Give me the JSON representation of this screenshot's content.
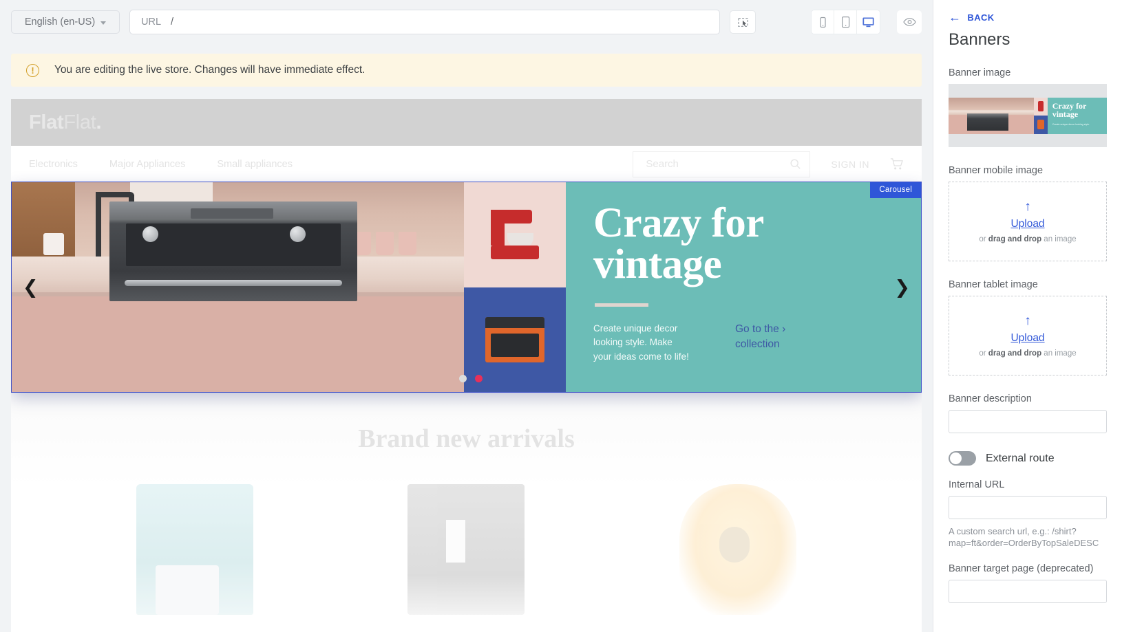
{
  "toolbar": {
    "language": "English (en-US)",
    "url_label": "URL",
    "url_value": "/",
    "select_tool_icon": "cursor-select-icon",
    "mobile_icon": "mobile-device-icon",
    "tablet_icon": "tablet-device-icon",
    "desktop_icon": "desktop-device-icon",
    "preview_icon": "eye-icon",
    "active_device": "desktop",
    "accent_color": "#2f56d8"
  },
  "notice": {
    "icon": "warning-circle-icon",
    "text": "You are editing the live store. Changes will have immediate effect.",
    "bg_color": "#fdf6e3",
    "icon_color": "#d3a02a"
  },
  "store": {
    "logo_bold": "Flat",
    "logo_light": "Flat",
    "logo_dot": ".",
    "nav": [
      {
        "label": "Electronics"
      },
      {
        "label": "Major Appliances"
      },
      {
        "label": "Small appliances"
      }
    ],
    "search_placeholder": "Search",
    "search_icon": "search-icon",
    "signin_label": "SIGN IN",
    "cart_icon": "shopping-cart-icon"
  },
  "carousel": {
    "badge": "Carousel",
    "prev_icon": "chevron-left-icon",
    "next_icon": "chevron-right-icon",
    "selected_outline_color": "#3f51c8",
    "teal_color": "#6cbdb7",
    "slide": {
      "title_line1": "Crazy for",
      "title_line2": "vintage",
      "description": "Create unique decor looking style. Make your ideas come to life!",
      "cta_line1": "Go to the ",
      "cta_chevron": "›",
      "cta_line2": "collection"
    },
    "dots": [
      {
        "active": false
      },
      {
        "active": true
      }
    ]
  },
  "arrivals": {
    "heading": "Brand new arrivals",
    "products": [
      {
        "name": "coffee-maker-teal"
      },
      {
        "name": "espresso-machine-silver"
      },
      {
        "name": "kettle-cream"
      }
    ]
  },
  "sidebar": {
    "back_label": "BACK",
    "back_icon": "arrow-left-icon",
    "title": "Banners",
    "banner_image_label": "Banner image",
    "banner_thumb": {
      "title_line1": "Crazy for",
      "title_line2": "vintage",
      "caption": "Create unique decor looking style."
    },
    "mobile_image_label": "Banner mobile image",
    "tablet_image_label": "Banner tablet image",
    "upload": {
      "icon": "upload-arrow-icon",
      "link": "Upload",
      "hint_pre": "or ",
      "hint_bold": "drag and drop",
      "hint_post": " an image"
    },
    "description_label": "Banner description",
    "description_value": "",
    "external_route_label": "External route",
    "external_route_on": false,
    "internal_url_label": "Internal URL",
    "internal_url_value": "",
    "internal_url_help": "A custom search url, e.g.: /shirt?map=ft&order=OrderByTopSaleDESC",
    "target_page_label": "Banner target page (deprecated)",
    "target_page_value": ""
  }
}
